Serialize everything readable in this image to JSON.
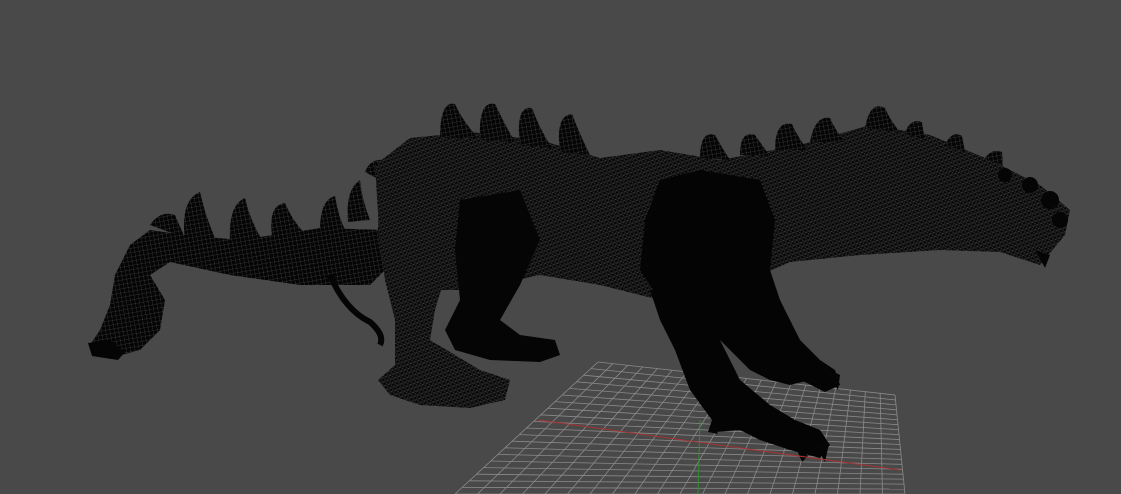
{
  "viewport": {
    "background_color": "#494949",
    "grid_line_color": "#8a8a8a",
    "x_axis_color": "#a83232",
    "z_axis_color": "#2f8f2f",
    "model_color": "#050505",
    "wireframe_color": "#6f6f6f",
    "display_mode": "wireframe"
  }
}
